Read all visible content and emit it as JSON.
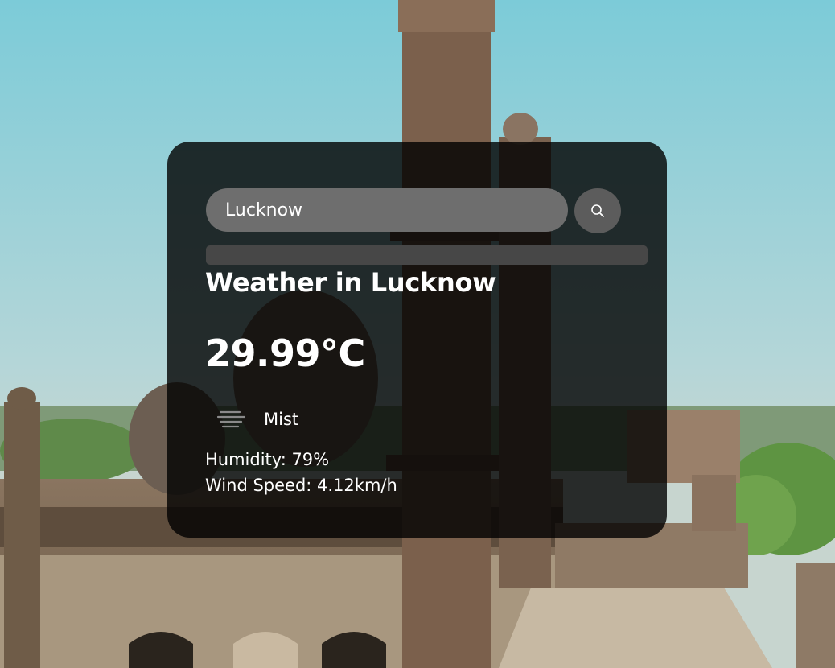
{
  "search": {
    "value": "Lucknow",
    "icon": "search-icon"
  },
  "weather": {
    "title": "Weather in Lucknow",
    "temperature": "29.99°C",
    "condition": "Mist",
    "condition_icon": "mist-icon",
    "humidity": "Humidity: 79%",
    "wind": "Wind Speed: 4.12km/h"
  },
  "colors": {
    "card_background": "#000000",
    "input_background": "#6e6e6e",
    "button_background": "#5c5c5c",
    "text": "#ffffff"
  }
}
